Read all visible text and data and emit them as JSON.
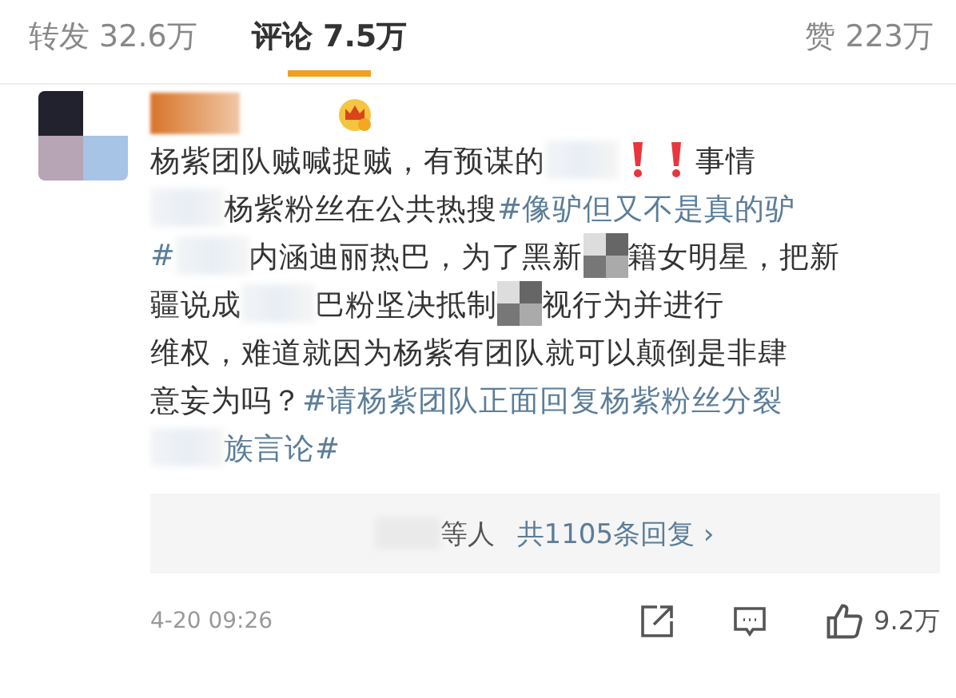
{
  "tabs": [
    {
      "label": "转发 32.6万",
      "selected": false
    },
    {
      "label": "评论 7.5万",
      "selected": true
    },
    {
      "label": "赞 223万",
      "selected": false
    }
  ],
  "comment": {
    "lines": [
      [
        {
          "kind": "text",
          "text": "杨紫团队贼喊捉贼，有预谋的"
        },
        {
          "kind": "blur"
        },
        {
          "kind": "alert"
        },
        {
          "kind": "alert"
        },
        {
          "kind": "text",
          "text": "事情"
        }
      ],
      [
        {
          "kind": "blur"
        },
        {
          "kind": "text",
          "text": "杨紫粉丝在公共热搜"
        },
        {
          "kind": "tag",
          "text": "#像驴但又不是真的驴"
        }
      ],
      [
        {
          "kind": "tag",
          "text": "#"
        },
        {
          "kind": "blur"
        },
        {
          "kind": "text",
          "text": "内涵迪丽热巴，为了黑新"
        },
        {
          "kind": "mosaic"
        },
        {
          "kind": "text",
          "text": "籍女明星，把新"
        }
      ],
      [
        {
          "kind": "text",
          "text": "疆说成"
        },
        {
          "kind": "blur"
        },
        {
          "kind": "text",
          "text": "巴粉坚决抵制"
        },
        {
          "kind": "mosaic"
        },
        {
          "kind": "text",
          "text": "视行为并进行"
        }
      ],
      [
        {
          "kind": "text",
          "text": "维权，难道就因为杨紫有团队就可以颠倒是非肆"
        }
      ],
      [
        {
          "kind": "text",
          "text": "意妄为吗？"
        },
        {
          "kind": "tag",
          "text": "#请杨紫团队正面回复杨紫粉丝分裂"
        }
      ],
      [
        {
          "kind": "blur"
        },
        {
          "kind": "tag",
          "text": "族言论#"
        }
      ]
    ],
    "replies": {
      "people": "等人",
      "link": "共1105条回复 ›"
    },
    "time": "4-20 09:26",
    "likes": "9.2万"
  }
}
